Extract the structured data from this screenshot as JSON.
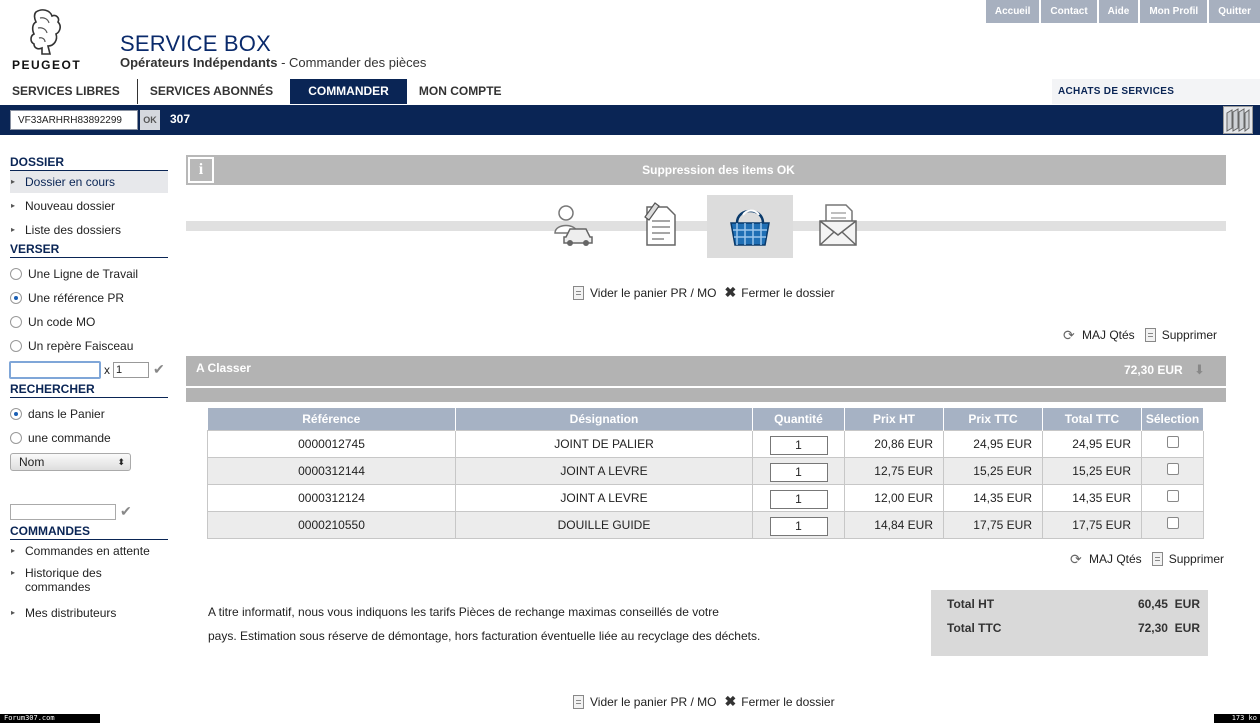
{
  "top_links": [
    "Accueil",
    "Contact",
    "Aide",
    "Mon Profil",
    "Quitter"
  ],
  "brand": "PEUGEOT",
  "app": {
    "title": "SERVICE BOX",
    "subtitle_bold": "Opérateurs Indépendants",
    "subtitle_rest": " - Commander des pièces"
  },
  "nav": {
    "tabs": [
      "SERVICES LIBRES",
      "SERVICES ABONNÉS",
      "COMMANDER",
      "MON COMPTE"
    ],
    "active": "COMMANDER",
    "right_label": "ACHATS DE SERVICES"
  },
  "vin": {
    "value": "VF33ARHRH83892299",
    "ok_label": "OK",
    "model": "307"
  },
  "sidebar": {
    "dossier_heading": "DOSSIER",
    "dossier_items": [
      "Dossier en cours",
      "Nouveau dossier",
      "Liste des dossiers"
    ],
    "verser_heading": "VERSER",
    "verser_options": [
      "Une Ligne de Travail",
      "Une référence PR",
      "Un code MO",
      "Un repère Faisceau"
    ],
    "verser_selected": "Une référence PR",
    "qty_x": "x",
    "qty_value": "1",
    "rechercher_heading": "RECHERCHER",
    "rechercher_options": [
      "dans le Panier",
      "une commande"
    ],
    "rechercher_selected": "dans le Panier",
    "select_value": "Nom",
    "commandes_heading": "COMMANDES",
    "commandes_items": [
      "Commandes en attente",
      "Historique des commandes",
      "Mes distributeurs"
    ]
  },
  "main": {
    "info_message": "Suppression des items OK",
    "steps": [
      "client-vehicle",
      "document-edit",
      "basket",
      "envelope"
    ],
    "active_step": "basket",
    "vider_label": "Vider le panier PR / MO",
    "fermer_label": "Fermer le dossier",
    "maj_label": "MAJ Qtés",
    "supprimer_label": "Supprimer",
    "group_name": "A Classer",
    "group_total": "72,30 EUR",
    "table": {
      "headers": [
        "Référence",
        "Désignation",
        "Quantité",
        "Prix HT",
        "Prix TTC",
        "Total TTC",
        "Sélection"
      ],
      "rows": [
        {
          "ref": "0000012745",
          "designation": "JOINT DE PALIER",
          "qty": "1",
          "prix_ht": "20,86 EUR",
          "prix_ttc": "24,95 EUR",
          "total_ttc": "24,95 EUR",
          "selected": false
        },
        {
          "ref": "0000312144",
          "designation": "JOINT A LEVRE",
          "qty": "1",
          "prix_ht": "12,75 EUR",
          "prix_ttc": "15,25 EUR",
          "total_ttc": "15,25 EUR",
          "selected": false
        },
        {
          "ref": "0000312124",
          "designation": "JOINT A LEVRE",
          "qty": "1",
          "prix_ht": "12,00 EUR",
          "prix_ttc": "14,35 EUR",
          "total_ttc": "14,35 EUR",
          "selected": false
        },
        {
          "ref": "0000210550",
          "designation": "DOUILLE GUIDE",
          "qty": "1",
          "prix_ht": "14,84 EUR",
          "prix_ttc": "17,75 EUR",
          "total_ttc": "17,75 EUR",
          "selected": false
        }
      ]
    },
    "note_line1": "A titre informatif, nous vous indiquons les tarifs Pièces de rechange maximas conseillés de votre",
    "note_line2": "pays. Estimation sous réserve de démontage, hors facturation éventuelle liée au recyclage des déchets.",
    "totals": {
      "ht_label": "Total HT",
      "ht_value": "60,45",
      "ht_currency": "EUR",
      "ttc_label": "Total TTC",
      "ttc_value": "72,30",
      "ttc_currency": "EUR"
    }
  },
  "footer": {
    "left": "Forum307.com",
    "right": "173 ko"
  },
  "colors": {
    "navy": "#0a2555",
    "header_grey": "#a6b2c4",
    "bar_grey": "#b3b3b3"
  }
}
